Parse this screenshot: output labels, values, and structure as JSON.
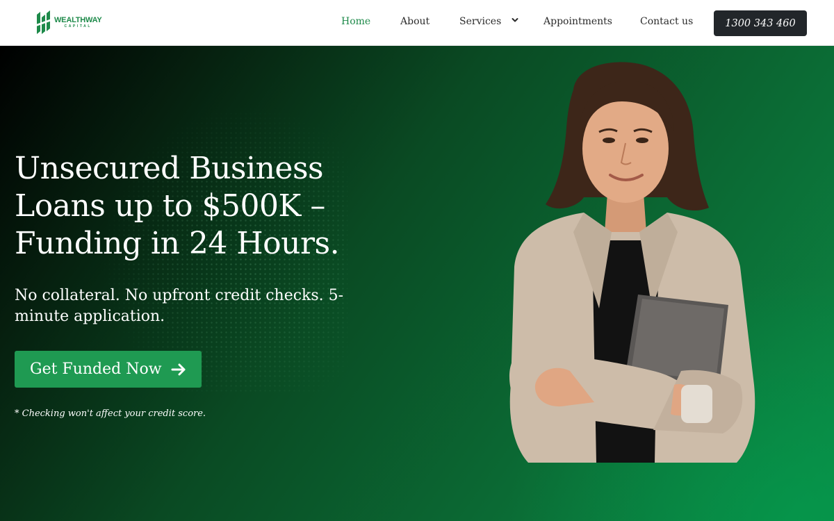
{
  "brand": {
    "name": "WEALTHWAY",
    "sub": "CAPITAL",
    "color": "#1e8a4a"
  },
  "nav": {
    "items": [
      {
        "label": "Home",
        "active": true
      },
      {
        "label": "About",
        "active": false
      },
      {
        "label": "Services",
        "active": false,
        "icon": "chevron-down-icon"
      },
      {
        "label": "Appointments",
        "active": false
      },
      {
        "label": "Contact us",
        "active": false
      }
    ],
    "phone": "1300 343 460"
  },
  "hero": {
    "headline": "Unsecured Business Loans up to $500K – Funding in 24 Hours.",
    "subheadline": "No collateral. No upfront credit checks. 5-minute application.",
    "cta_label": "Get Funded Now",
    "cta_icon": "arrow-right-icon",
    "disclaimer": "* Checking won't affect your credit score.",
    "accent_color": "#1f9a52"
  }
}
